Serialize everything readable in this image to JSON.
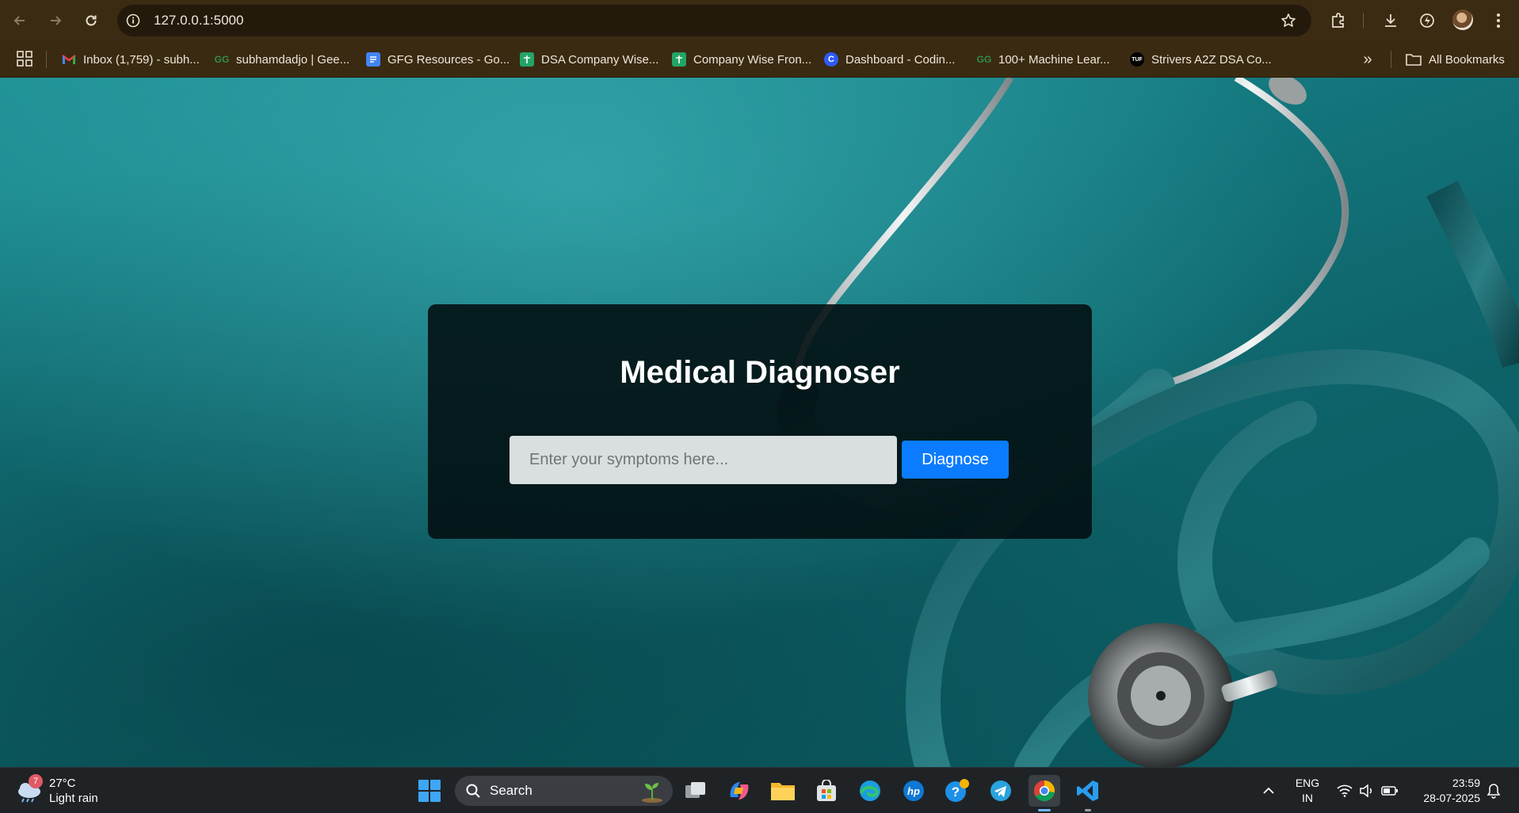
{
  "browser": {
    "url": "127.0.0.1:5000",
    "bookmarks": [
      {
        "label": "Inbox (1,759) - subh...",
        "icon": "gmail-icon"
      },
      {
        "label": "subhamdadjo | Gee...",
        "icon": "geeksforgeeks-icon"
      },
      {
        "label": "GFG Resources - Go...",
        "icon": "google-docs-icon"
      },
      {
        "label": "DSA Company Wise...",
        "icon": "google-sheets-icon"
      },
      {
        "label": "Company Wise Fron...",
        "icon": "google-sheets-icon"
      },
      {
        "label": "Dashboard - Codin...",
        "icon": "codolio-icon"
      },
      {
        "label": "100+ Machine Lear...",
        "icon": "geeksforgeeks-icon"
      },
      {
        "label": "Strivers A2Z DSA Co...",
        "icon": "takeuforward-icon"
      }
    ],
    "all_bookmarks_label": "All Bookmarks",
    "more_label": "»"
  },
  "page": {
    "title": "Medical Diagnoser",
    "input_placeholder": "Enter your symptoms here...",
    "input_value": "",
    "button_label": "Diagnose",
    "colors": {
      "button": "#0b7cff",
      "card": "#020e10",
      "background": "#147a80"
    }
  },
  "taskbar": {
    "weather": {
      "temp": "27°C",
      "condition": "Light rain",
      "badge": "7"
    },
    "search_label": "Search",
    "apps": [
      "windows-start",
      "task-view",
      "copilot",
      "file-explorer",
      "microsoft-store",
      "edge",
      "hp",
      "get-help",
      "telegram",
      "chrome",
      "vs-code"
    ],
    "lang_line1": "ENG",
    "lang_line2": "IN",
    "time": "23:59",
    "date": "28-07-2025"
  }
}
